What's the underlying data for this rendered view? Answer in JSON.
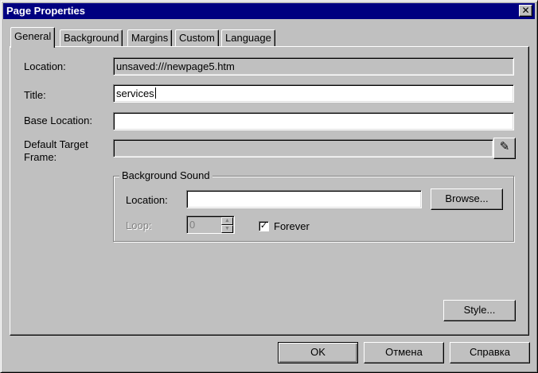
{
  "window": {
    "title": "Page Properties",
    "close_glyph": "✕"
  },
  "tabs": [
    {
      "label": "General",
      "active": true
    },
    {
      "label": "Background"
    },
    {
      "label": "Margins"
    },
    {
      "label": "Custom"
    },
    {
      "label": "Language"
    }
  ],
  "general": {
    "location_label": "Location:",
    "location_value": "unsaved:///newpage5.htm",
    "title_label": "Title:",
    "title_value": "services",
    "base_location_label": "Base Location:",
    "base_location_value": "",
    "default_target_label_1": "Default Target",
    "default_target_label_2": "Frame:",
    "default_target_value": "",
    "edit_glyph": "✎"
  },
  "background_sound": {
    "group_title": "Background Sound",
    "location_label": "Location:",
    "location_value": "",
    "browse_label": "Browse...",
    "loop_label": "Loop:",
    "loop_value": "0",
    "forever_label": "Forever",
    "forever_checked": true,
    "check_glyph": "✓"
  },
  "style_button": "Style...",
  "footer": {
    "ok": "OK",
    "cancel": "Отмена",
    "help": "Справка"
  }
}
